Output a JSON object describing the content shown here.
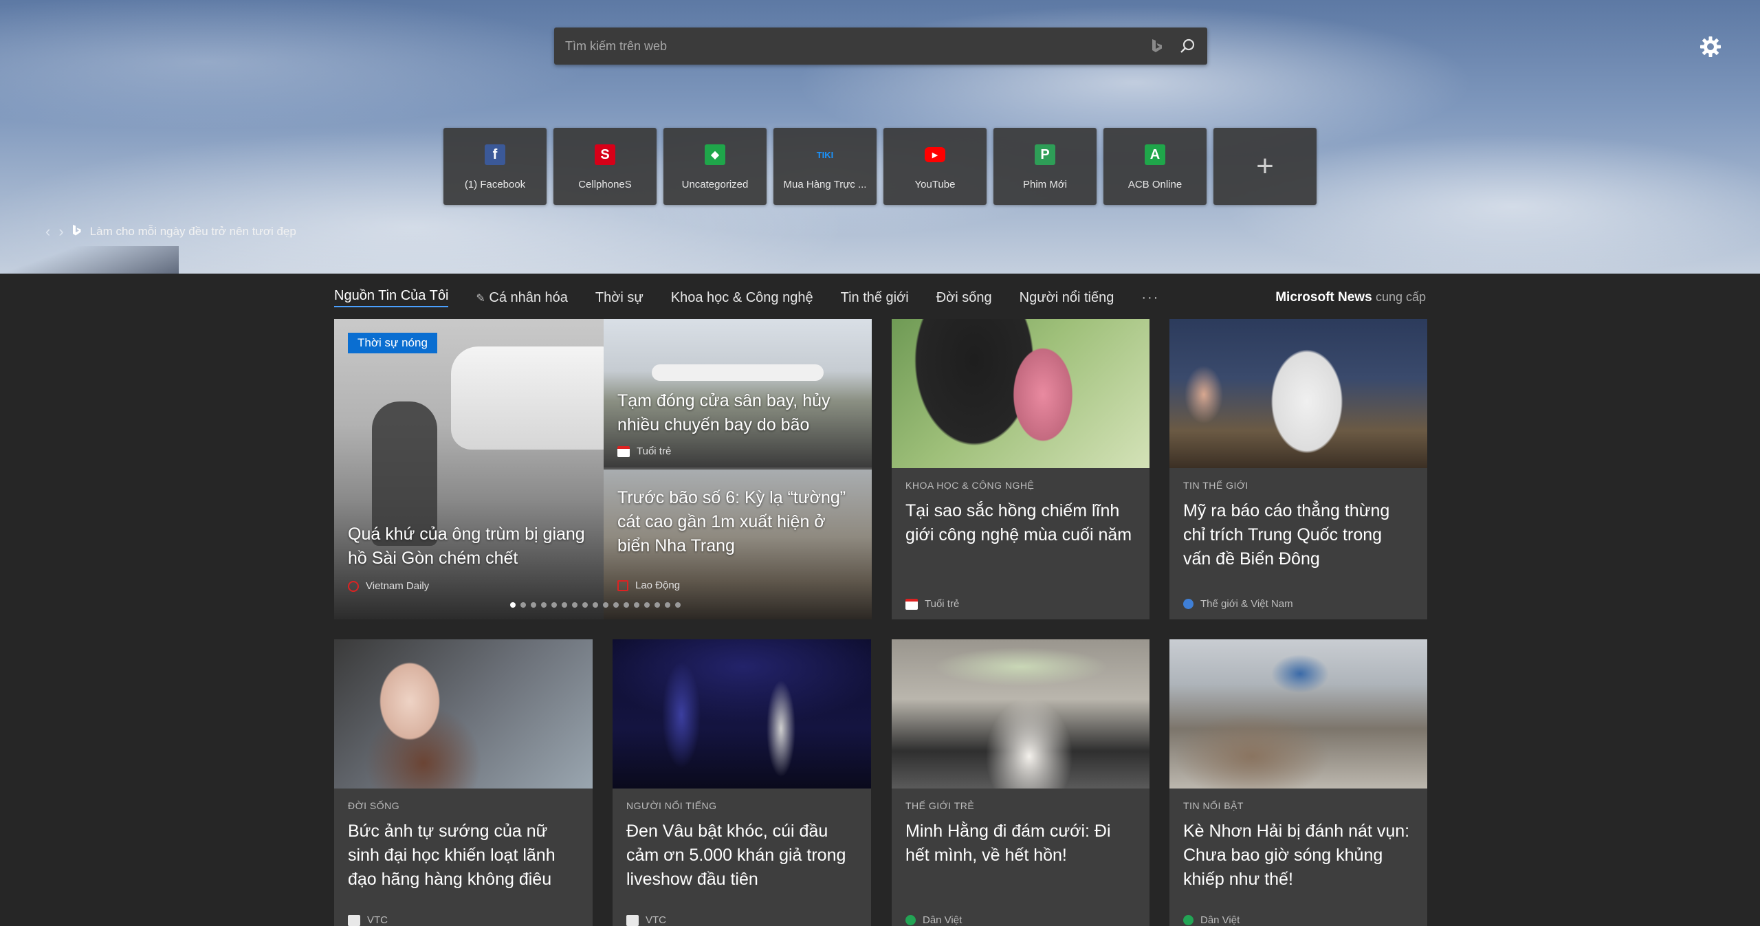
{
  "search": {
    "placeholder": "Tìm kiếm trên web"
  },
  "quick_links": [
    {
      "label": "(1) Facebook",
      "glyph": "f",
      "color": "#3b5998"
    },
    {
      "label": "CellphoneS",
      "glyph": "S",
      "color": "#d70018"
    },
    {
      "label": "Uncategorized",
      "glyph": "◆",
      "color": "#1fa64a"
    },
    {
      "label": "Mua Hàng Trực ...",
      "glyph": "TIKI",
      "color": "#1a94ff"
    },
    {
      "label": "YouTube",
      "glyph": "▶",
      "color": "#ff0000"
    },
    {
      "label": "Phim Mới",
      "glyph": "P",
      "color": "#2e9e57"
    },
    {
      "label": "ACB Online",
      "glyph": "A",
      "color": "#1fa64a"
    }
  ],
  "tagline": "Làm cho mỗi ngày đều trở nên tươi đẹp",
  "nav": {
    "items": [
      "Nguồn Tin Của Tôi",
      "Cá nhân hóa",
      "Thời sự",
      "Khoa học & Công nghệ",
      "Tin thế giới",
      "Đời sống",
      "Người nổi tiếng"
    ],
    "more": "···",
    "provider": "Microsoft News",
    "provider_suffix": "cung cấp"
  },
  "carousel": {
    "badge": "Thời sự nóng",
    "main": {
      "title": "Quá khứ của ông trùm bị giang hồ Sài Gòn chém chết",
      "source": "Vietnam Daily"
    },
    "top": {
      "title": "Tạm đóng cửa sân bay, hủy nhiều chuyến bay do bão",
      "source": "Tuổi trẻ"
    },
    "bottom": {
      "title": "Trước bão số 6: Kỳ lạ “tường” cát cao gần 1m xuất hiện ở biển Nha Trang",
      "source": "Lao Động"
    },
    "dots": 17
  },
  "cards": [
    {
      "category": "KHOA HỌC & CÔNG NGHỆ",
      "title": "Tại sao sắc hồng chiếm lĩnh giới công nghệ mùa cuối năm",
      "source": "Tuổi trẻ"
    },
    {
      "category": "TIN THẾ GIỚI",
      "title": "Mỹ ra báo cáo thẳng thừng chỉ trích Trung Quốc trong vấn đề Biển Đông",
      "source": "Thế giới & Việt Nam"
    },
    {
      "category": "ĐỜI SỐNG",
      "title": "Bức ảnh tự sướng của nữ sinh đại học khiến loạt lãnh đạo hãng hàng không điêu",
      "source": "VTC"
    },
    {
      "category": "NGƯỜI NỔI TIẾNG",
      "title": "Đen Vâu bật khóc, cúi đầu cảm ơn 5.000 khán giả trong liveshow đầu tiên",
      "source": "VTC"
    },
    {
      "category": "THẾ GIỚI TRẺ",
      "title": "Minh Hằng đi đám cưới: Đi hết mình, về hết hồn!",
      "source": "Dân Việt"
    },
    {
      "category": "TIN NỔI BẬT",
      "title": "Kè Nhơn Hải bị đánh nát vụn: Chưa bao giờ sóng khủng khiếp như thế!",
      "source": "Dân Việt"
    }
  ]
}
